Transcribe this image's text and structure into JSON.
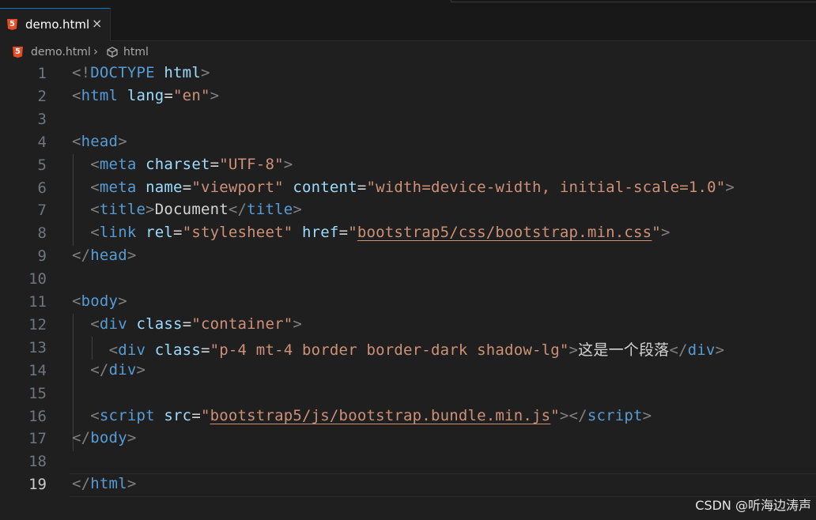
{
  "tab": {
    "label": "demo.html",
    "close": "×",
    "file_icon": "html5-icon"
  },
  "breadcrumb": {
    "file": "demo.html",
    "separator": "›",
    "symbol": "html"
  },
  "lines": [
    {
      "n": "1",
      "tokens": [
        [
          "p",
          "<!"
        ],
        [
          "t",
          "DOCTYPE"
        ],
        [
          "txt",
          " "
        ],
        [
          "a",
          "html"
        ],
        [
          "p",
          ">"
        ]
      ]
    },
    {
      "n": "2",
      "tokens": [
        [
          "p",
          "<"
        ],
        [
          "t",
          "html"
        ],
        [
          "txt",
          " "
        ],
        [
          "a",
          "lang"
        ],
        [
          "txt",
          "="
        ],
        [
          "s",
          "\"en\""
        ],
        [
          "p",
          ">"
        ]
      ]
    },
    {
      "n": "3",
      "tokens": []
    },
    {
      "n": "4",
      "tokens": [
        [
          "p",
          "<"
        ],
        [
          "t",
          "head"
        ],
        [
          "p",
          ">"
        ]
      ]
    },
    {
      "n": "5",
      "tokens": [
        [
          "txt",
          "  "
        ],
        [
          "p",
          "<"
        ],
        [
          "t",
          "meta"
        ],
        [
          "txt",
          " "
        ],
        [
          "a",
          "charset"
        ],
        [
          "txt",
          "="
        ],
        [
          "s",
          "\"UTF-8\""
        ],
        [
          "p",
          ">"
        ]
      ]
    },
    {
      "n": "6",
      "tokens": [
        [
          "txt",
          "  "
        ],
        [
          "p",
          "<"
        ],
        [
          "t",
          "meta"
        ],
        [
          "txt",
          " "
        ],
        [
          "a",
          "name"
        ],
        [
          "txt",
          "="
        ],
        [
          "s",
          "\"viewport\""
        ],
        [
          "txt",
          " "
        ],
        [
          "a",
          "content"
        ],
        [
          "txt",
          "="
        ],
        [
          "s",
          "\"width=device-width, initial-scale=1.0\""
        ],
        [
          "p",
          ">"
        ]
      ]
    },
    {
      "n": "7",
      "tokens": [
        [
          "txt",
          "  "
        ],
        [
          "p",
          "<"
        ],
        [
          "t",
          "title"
        ],
        [
          "p",
          ">"
        ],
        [
          "txt",
          "Document"
        ],
        [
          "p",
          "</"
        ],
        [
          "t",
          "title"
        ],
        [
          "p",
          ">"
        ]
      ]
    },
    {
      "n": "8",
      "tokens": [
        [
          "txt",
          "  "
        ],
        [
          "p",
          "<"
        ],
        [
          "t",
          "link"
        ],
        [
          "txt",
          " "
        ],
        [
          "a",
          "rel"
        ],
        [
          "txt",
          "="
        ],
        [
          "s",
          "\"stylesheet\""
        ],
        [
          "txt",
          " "
        ],
        [
          "a",
          "href"
        ],
        [
          "txt",
          "="
        ],
        [
          "s",
          "\""
        ],
        [
          "su",
          "bootstrap5/css/bootstrap.min.css"
        ],
        [
          "s",
          "\""
        ],
        [
          "p",
          ">"
        ]
      ]
    },
    {
      "n": "9",
      "tokens": [
        [
          "p",
          "</"
        ],
        [
          "t",
          "head"
        ],
        [
          "p",
          ">"
        ]
      ]
    },
    {
      "n": "10",
      "tokens": []
    },
    {
      "n": "11",
      "tokens": [
        [
          "p",
          "<"
        ],
        [
          "t",
          "body"
        ],
        [
          "p",
          ">"
        ]
      ]
    },
    {
      "n": "12",
      "tokens": [
        [
          "txt",
          "  "
        ],
        [
          "p",
          "<"
        ],
        [
          "t",
          "div"
        ],
        [
          "txt",
          " "
        ],
        [
          "a",
          "class"
        ],
        [
          "txt",
          "="
        ],
        [
          "s",
          "\"container\""
        ],
        [
          "p",
          ">"
        ]
      ]
    },
    {
      "n": "13",
      "tokens": [
        [
          "txt",
          "    "
        ],
        [
          "p",
          "<"
        ],
        [
          "t",
          "div"
        ],
        [
          "txt",
          " "
        ],
        [
          "a",
          "class"
        ],
        [
          "txt",
          "="
        ],
        [
          "s",
          "\"p-4 mt-4 border border-dark shadow-lg\""
        ],
        [
          "p",
          ">"
        ],
        [
          "txt",
          "这是一个段落"
        ],
        [
          "p",
          "</"
        ],
        [
          "t",
          "div"
        ],
        [
          "p",
          ">"
        ]
      ]
    },
    {
      "n": "14",
      "tokens": [
        [
          "txt",
          "  "
        ],
        [
          "p",
          "</"
        ],
        [
          "t",
          "div"
        ],
        [
          "p",
          ">"
        ]
      ]
    },
    {
      "n": "15",
      "tokens": []
    },
    {
      "n": "16",
      "tokens": [
        [
          "txt",
          "  "
        ],
        [
          "p",
          "<"
        ],
        [
          "t",
          "script"
        ],
        [
          "txt",
          " "
        ],
        [
          "a",
          "src"
        ],
        [
          "txt",
          "="
        ],
        [
          "s",
          "\""
        ],
        [
          "su",
          "bootstrap5/js/bootstrap.bundle.min.js"
        ],
        [
          "s",
          "\""
        ],
        [
          "p",
          "></"
        ],
        [
          "t",
          "script"
        ],
        [
          "p",
          ">"
        ]
      ]
    },
    {
      "n": "17",
      "tokens": [
        [
          "p",
          "</"
        ],
        [
          "t",
          "body"
        ],
        [
          "p",
          ">"
        ]
      ]
    },
    {
      "n": "18",
      "tokens": []
    },
    {
      "n": "19",
      "tokens": [
        [
          "p",
          "</"
        ],
        [
          "t",
          "html"
        ],
        [
          "p",
          ">"
        ]
      ]
    }
  ],
  "current_line": "19",
  "watermark": "CSDN @听海边涛声",
  "colors": {
    "tag": "#569cd6",
    "attribute": "#9cdcfe",
    "string": "#ce9178",
    "punctuation": "#808080",
    "text": "#d4d4d4",
    "background": "#1f1f1f"
  }
}
